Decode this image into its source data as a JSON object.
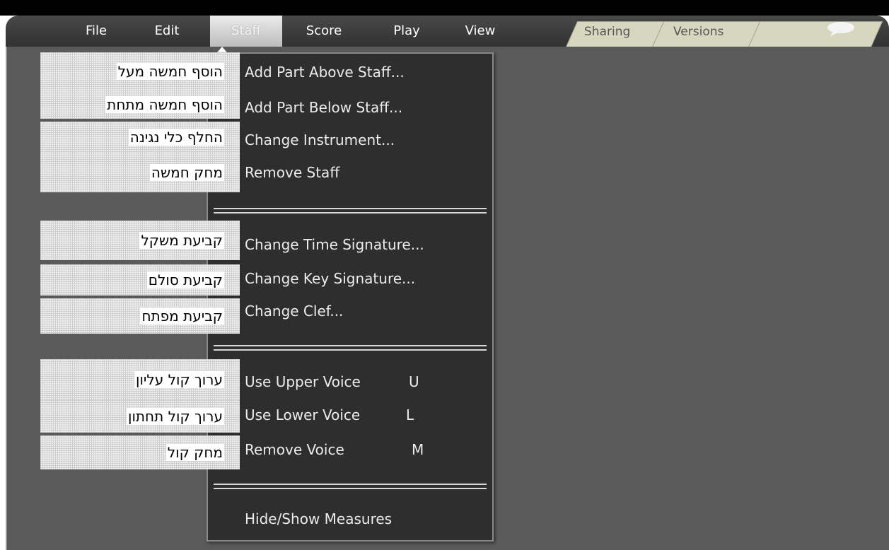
{
  "menubar": {
    "items": [
      "File",
      "Edit",
      "Staff",
      "Score",
      "Play",
      "View"
    ],
    "active": "Staff",
    "tabs": [
      "Sharing",
      "Versions"
    ]
  },
  "staff_menu": {
    "groups": [
      [
        {
          "label": "Add Part Above Staff...",
          "hebrew": "הוסף חמשה מעל"
        },
        {
          "label": "Add Part Below Staff...",
          "hebrew": "הוסף חמשה מתחת"
        },
        {
          "label": "Change Instrument...",
          "hebrew": "החלף כלי נגינה"
        },
        {
          "label": "Remove Staff",
          "hebrew": "מחק חמשה"
        }
      ],
      [
        {
          "label": "Change Time Signature...",
          "hebrew": "קביעת משקל"
        },
        {
          "label": "Change Key Signature...",
          "hebrew": "קביעת סולם"
        },
        {
          "label": "Change Clef...",
          "hebrew": "קביעת מפתח"
        }
      ],
      [
        {
          "label": "Use Upper Voice",
          "shortcut": "U",
          "hebrew": "ערוך קול עליון"
        },
        {
          "label": "Use Lower Voice",
          "shortcut": "L",
          "hebrew": "ערוך קול תחתון"
        },
        {
          "label": "Remove Voice",
          "shortcut": "M",
          "hebrew": "מחק קול"
        }
      ],
      [
        {
          "label": "Hide/Show Measures"
        }
      ]
    ]
  },
  "icons": {
    "chat": "speech-bubble-icon"
  }
}
